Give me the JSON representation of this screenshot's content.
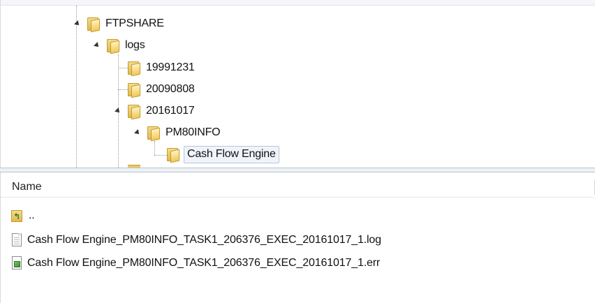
{
  "tree": {
    "nodes": [
      {
        "id": "ftpshare",
        "label": "FTPSHARE",
        "icon": "folder-icon",
        "expanded": true
      },
      {
        "id": "logs",
        "label": "logs",
        "icon": "folder-icon",
        "expanded": true
      },
      {
        "id": "n19991231",
        "label": "19991231",
        "icon": "folder-icon",
        "expanded": false
      },
      {
        "id": "n20090808",
        "label": "20090808",
        "icon": "folder-icon",
        "expanded": false
      },
      {
        "id": "n20161017",
        "label": "20161017",
        "icon": "folder-icon",
        "expanded": true
      },
      {
        "id": "pm80info",
        "label": "PM80INFO",
        "icon": "folder-icon",
        "expanded": true
      },
      {
        "id": "cashflow",
        "label": "Cash Flow Engine",
        "icon": "folder-icon",
        "selected": true
      }
    ]
  },
  "list": {
    "column_name": "Name",
    "parent_label": "..",
    "files": [
      {
        "name": "Cash Flow Engine_PM80INFO_TASK1_206376_EXEC_20161017_1.log",
        "icon": "text-file-icon"
      },
      {
        "name": "Cash Flow Engine_PM80INFO_TASK1_206376_EXEC_20161017_1.err",
        "icon": "err-file-icon"
      }
    ]
  },
  "colors": {
    "folder": "#e3b84e",
    "selection_border": "#b8c7da",
    "splitter": "#eef1f5"
  }
}
